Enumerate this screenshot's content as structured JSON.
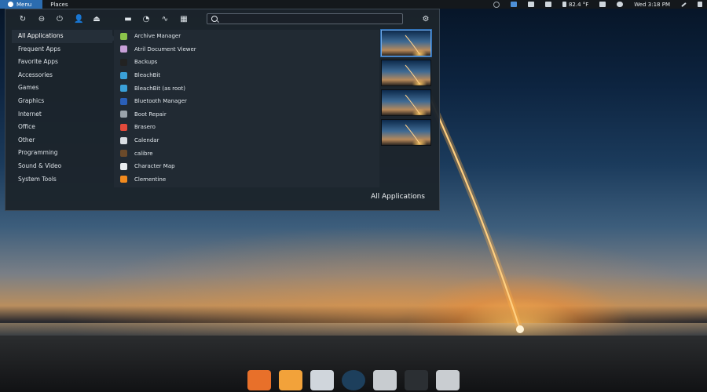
{
  "top_panel": {
    "menu_label": "Menu",
    "places_label": "Places",
    "weather": "82.4 °F",
    "clock": "Wed  3:18 PM",
    "tray_icons": [
      "record-icon",
      "picture-icon",
      "shield-icon",
      "monitor-icon",
      "phone-icon",
      "weather-icon",
      "eject-icon",
      "cloud-icon",
      "pen-icon",
      "volume-icon"
    ]
  },
  "toolbar": {
    "icons": [
      "refresh-icon",
      "lock-icon",
      "power-icon",
      "user-switch-icon",
      "eject-icon",
      "folder-icon",
      "software-center-icon",
      "monitor-tool-icon",
      "apps-grid-icon"
    ],
    "settings_icon": "gear-icon"
  },
  "search": {
    "value": "",
    "placeholder": ""
  },
  "categories": [
    {
      "label": "All Applications"
    },
    {
      "label": "Frequent Apps"
    },
    {
      "label": "Favorite Apps"
    },
    {
      "label": "Accessories"
    },
    {
      "label": "Games"
    },
    {
      "label": "Graphics"
    },
    {
      "label": "Internet"
    },
    {
      "label": "Office"
    },
    {
      "label": "Other"
    },
    {
      "label": "Programming"
    },
    {
      "label": "Sound & Video"
    },
    {
      "label": "System Tools"
    }
  ],
  "apps": [
    {
      "label": "Archive Manager",
      "icon": "archive-icon",
      "color": "#8bc34a"
    },
    {
      "label": "Atril Document Viewer",
      "icon": "document-viewer-icon",
      "color": "#c8a0d8"
    },
    {
      "label": "Backups",
      "icon": "backups-icon",
      "color": "#222222"
    },
    {
      "label": "BleachBit",
      "icon": "bleachbit-icon",
      "color": "#3aa0d8"
    },
    {
      "label": "BleachBit (as root)",
      "icon": "bleachbit-root-icon",
      "color": "#3aa0d8"
    },
    {
      "label": "Bluetooth Manager",
      "icon": "bluetooth-icon",
      "color": "#2a5fb8"
    },
    {
      "label": "Boot Repair",
      "icon": "boot-repair-icon",
      "color": "#9aa3ab"
    },
    {
      "label": "Brasero",
      "icon": "brasero-icon",
      "color": "#e24a3b"
    },
    {
      "label": "Calendar",
      "icon": "calendar-icon",
      "color": "#d9dee3"
    },
    {
      "label": "calibre",
      "icon": "calibre-icon",
      "color": "#6b4a2a"
    },
    {
      "label": "Character Map",
      "icon": "character-map-icon",
      "color": "#e9ecef"
    },
    {
      "label": "Clementine",
      "icon": "clementine-icon",
      "color": "#f28a1e"
    }
  ],
  "footer": {
    "label": "All Applications"
  },
  "dock": [
    {
      "icon": "firefox-icon",
      "color": "#e8702a"
    },
    {
      "icon": "clapper-icon",
      "color": "#f2a23a"
    },
    {
      "icon": "software-icon",
      "color": "#d0d6dc"
    },
    {
      "icon": "steam-icon",
      "color": "#1d3f5c"
    },
    {
      "icon": "mixer-icon",
      "color": "#c8ccd0"
    },
    {
      "icon": "terminal-icon",
      "color": "#2b2f33"
    },
    {
      "icon": "trash-icon",
      "color": "#c9cdd1"
    }
  ]
}
